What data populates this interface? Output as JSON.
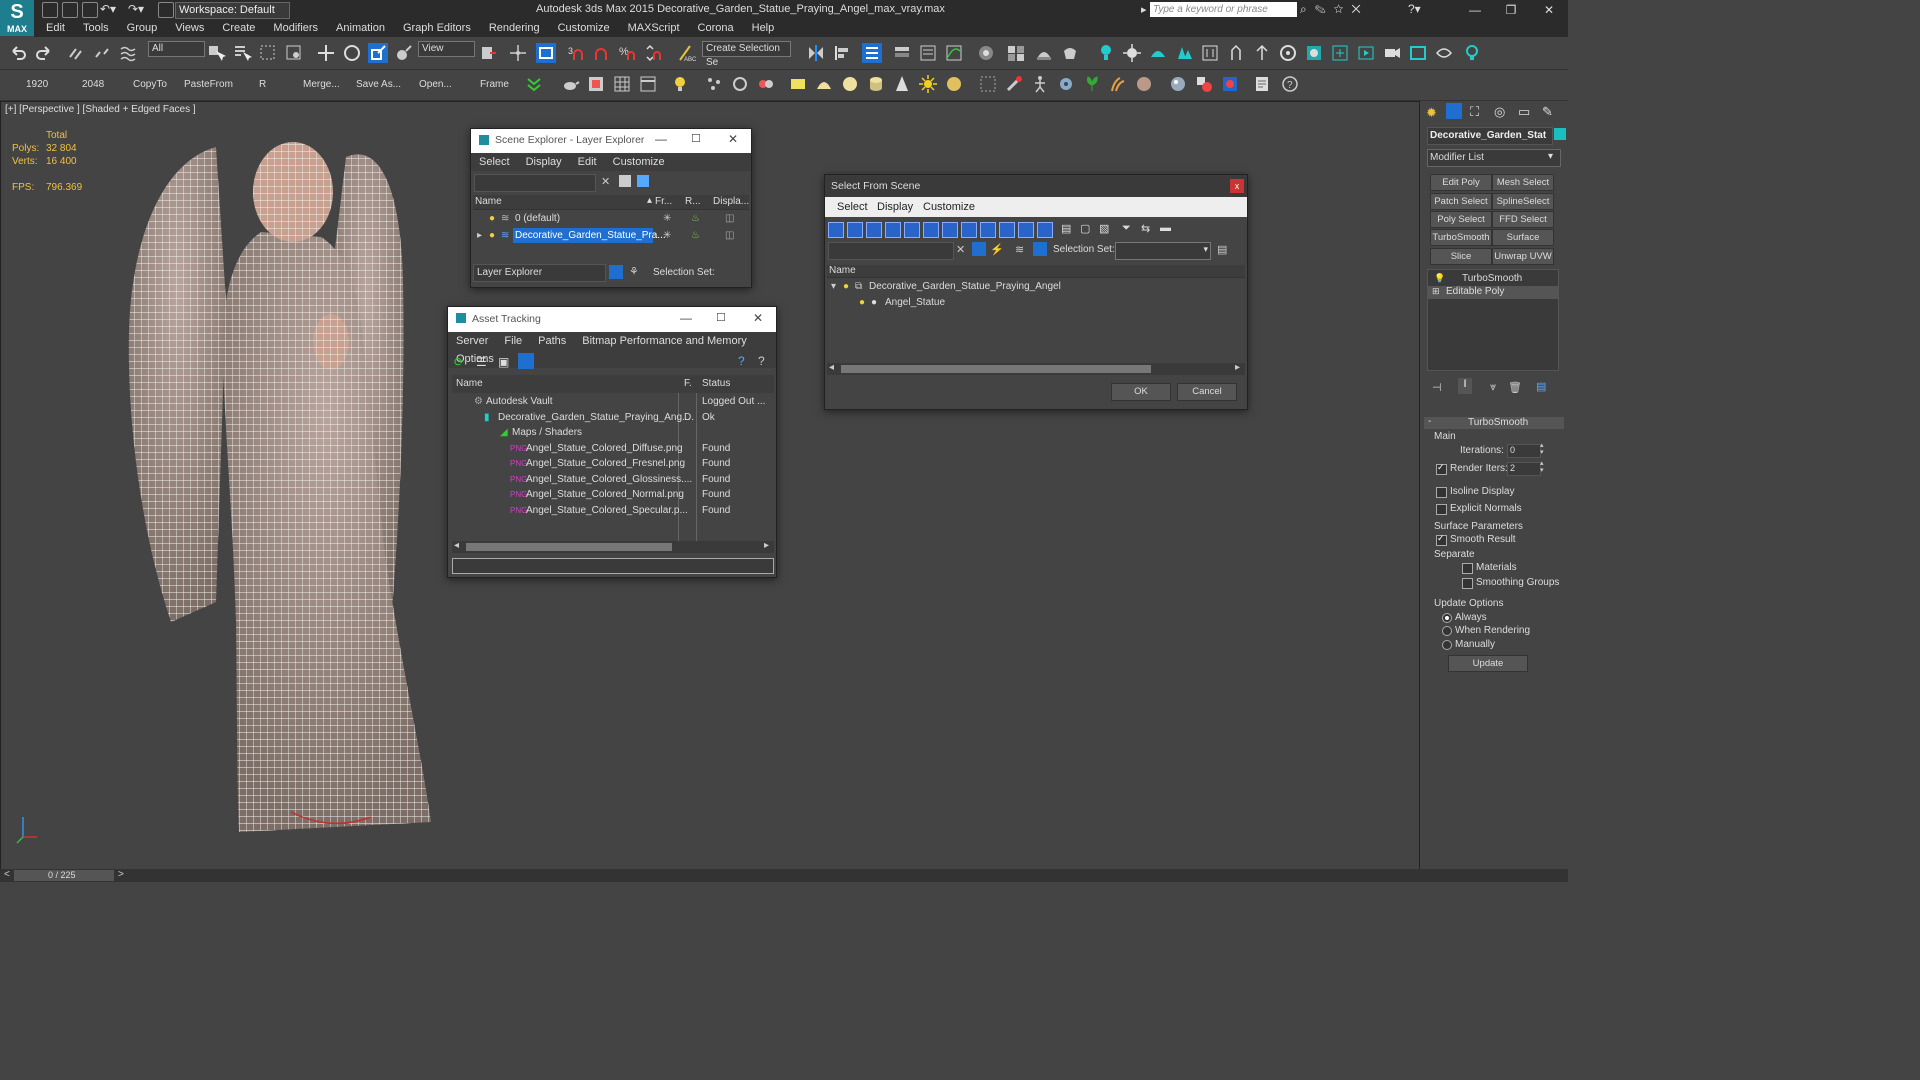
{
  "app": {
    "logo_text": "MAX",
    "workspace": "Workspace: Default",
    "title": "Autodesk 3ds Max  2015    Decorative_Garden_Statue_Praying_Angel_max_vray.max",
    "search_placeholder": "Type a keyword or phrase"
  },
  "menu": [
    "Edit",
    "Tools",
    "Group",
    "Views",
    "Create",
    "Modifiers",
    "Animation",
    "Graph Editors",
    "Rendering",
    "Customize",
    "MAXScript",
    "Corona",
    "Help"
  ],
  "toolbar": {
    "selection_filter": "All",
    "ref_coord": "View",
    "selection_set": "Create Selection Se",
    "quick": [
      "1920",
      "2048",
      "CopyTo",
      "PasteFrom",
      "R",
      "Merge...",
      "Save As...",
      "Open...",
      "Frame"
    ]
  },
  "viewport": {
    "label": "[+] [Perspective ] [Shaded + Edged Faces ]",
    "stats_header": "Total",
    "polys_label": "Polys:",
    "polys_value": "32 804",
    "verts_label": "Verts:",
    "verts_value": "16 400",
    "fps_label": "FPS:",
    "fps_value": "796.369"
  },
  "scene_explorer": {
    "title": "Scene Explorer - Layer Explorer",
    "menu": [
      "Select",
      "Display",
      "Edit",
      "Customize"
    ],
    "columns": [
      "Name",
      "Fr...",
      "R...",
      "Displa..."
    ],
    "rows": [
      "0 (default)",
      "Decorative_Garden_Statue_Pra..."
    ],
    "footer_dropdown": "Layer Explorer",
    "footer_label": "Selection Set:"
  },
  "asset_tracking": {
    "title": "Asset Tracking",
    "menu": [
      "Server",
      "File",
      "Paths",
      "Bitmap Performance and Memory",
      "Options"
    ],
    "columns": [
      "Name",
      "F.",
      "Status"
    ],
    "rows": [
      {
        "name": "Autodesk Vault",
        "f": "",
        "status": "Logged Out ..."
      },
      {
        "name": "Decorative_Garden_Statue_Praying_Ang...",
        "f": "D.",
        "status": "Ok"
      },
      {
        "name": "Maps / Shaders",
        "f": "",
        "status": ""
      },
      {
        "name": "Angel_Statue_Colored_Diffuse.png",
        "f": "",
        "status": "Found"
      },
      {
        "name": "Angel_Statue_Colored_Fresnel.png",
        "f": "",
        "status": "Found"
      },
      {
        "name": "Angel_Statue_Colored_Glossiness....",
        "f": "",
        "status": "Found"
      },
      {
        "name": "Angel_Statue_Colored_Normal.png",
        "f": "",
        "status": "Found"
      },
      {
        "name": "Angel_Statue_Colored_Specular.p...",
        "f": "",
        "status": "Found"
      }
    ]
  },
  "select_from_scene": {
    "title": "Select From Scene",
    "close": "x",
    "menu": [
      "Select",
      "Display",
      "Customize"
    ],
    "selection_set_label": "Selection Set:",
    "column": "Name",
    "rows": [
      "Decorative_Garden_Statue_Praying_Angel",
      "Angel_Statue"
    ],
    "ok": "OK",
    "cancel": "Cancel"
  },
  "command_panel": {
    "object_name": "Decorative_Garden_Stat",
    "modifier_list": "Modifier List",
    "buttons": [
      "Edit Poly",
      "Mesh Select",
      "Patch Select",
      "SplineSelect",
      "Poly Select",
      "FFD Select",
      "TurboSmooth",
      "Surface Select",
      "Slice",
      "Unwrap UVW"
    ],
    "stack": [
      "TurboSmooth",
      "Editable Poly"
    ],
    "rollout_title": "TurboSmooth",
    "main_label": "Main",
    "iterations_label": "Iterations:",
    "iterations_value": "0",
    "render_iters_label": "Render Iters:",
    "render_iters_value": "2",
    "isoline": "Isoline Display",
    "explicit_normals": "Explicit Normals",
    "surface_params": "Surface Parameters",
    "smooth_result": "Smooth Result",
    "separate": "Separate",
    "materials": "Materials",
    "smoothing_groups": "Smoothing Groups",
    "update_options": "Update Options",
    "always": "Always",
    "when_rendering": "When Rendering",
    "manually": "Manually",
    "update_button": "Update"
  },
  "timeline": {
    "frame": "0 / 225"
  },
  "colors": {
    "accent": "#1e7e8e",
    "selection": "#1f6fd1",
    "stat_yellow": "#f0c040",
    "icon_pink": "#d040c0"
  }
}
